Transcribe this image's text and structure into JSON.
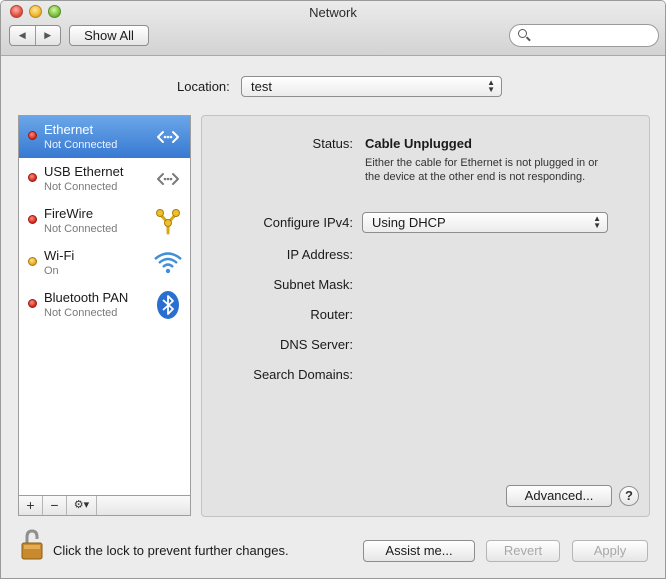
{
  "window": {
    "title": "Network"
  },
  "toolbar": {
    "back_glyph": "◀",
    "forward_glyph": "▶",
    "show_all_label": "Show All",
    "search_placeholder": ""
  },
  "location": {
    "label": "Location:",
    "value": "test"
  },
  "services": [
    {
      "name": "Ethernet",
      "status": "Not Connected",
      "dot": "red",
      "icon": "ethernet-icon",
      "selected": true
    },
    {
      "name": "USB Ethernet",
      "status": "Not Connected",
      "dot": "red",
      "icon": "usb-ethernet-icon",
      "selected": false
    },
    {
      "name": "FireWire",
      "status": "Not Connected",
      "dot": "red",
      "icon": "firewire-icon",
      "selected": false
    },
    {
      "name": "Wi-Fi",
      "status": "On",
      "dot": "yellow",
      "icon": "wifi-icon",
      "selected": false
    },
    {
      "name": "Bluetooth PAN",
      "status": "Not Connected",
      "dot": "red",
      "icon": "bluetooth-icon",
      "selected": false
    }
  ],
  "sidebar_tools": {
    "add": "+",
    "remove": "−",
    "gear": "⚙▾"
  },
  "detail": {
    "status_label": "Status:",
    "status_value": "Cable Unplugged",
    "status_description": "Either the cable for Ethernet is not plugged in or the device at the other end is not responding.",
    "configure_label": "Configure IPv4:",
    "configure_value": "Using DHCP",
    "ip_label": "IP Address:",
    "subnet_label": "Subnet Mask:",
    "router_label": "Router:",
    "dns_label": "DNS Server:",
    "search_domains_label": "Search Domains:",
    "advanced_label": "Advanced...",
    "help_label": "?"
  },
  "footer": {
    "lock_text": "Click the lock to prevent further changes.",
    "assist_label": "Assist me...",
    "revert_label": "Revert",
    "apply_label": "Apply"
  },
  "colors": {
    "selection": "#3779d2",
    "status_red": "#d1261a",
    "status_yellow": "#e6a317",
    "disabled_text": "#a8a8a8"
  }
}
